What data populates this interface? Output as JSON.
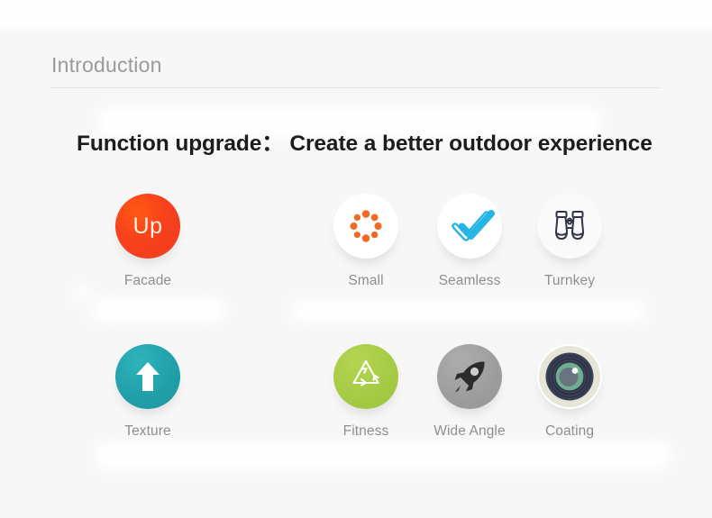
{
  "header": {
    "title": "Introduction"
  },
  "main": {
    "heading": "Function upgrade：  Create a better outdoor experience"
  },
  "features": {
    "rows": [
      {
        "items": [
          {
            "label": "Facade",
            "icon": "up-circle-icon",
            "icon_text": "Up",
            "color": "#f8421b"
          },
          {
            "label": "Small",
            "icon": "dot-spinner-icon",
            "icon_text": "",
            "color": "#f26a21"
          },
          {
            "label": "Seamless",
            "icon": "double-check-icon",
            "icon_text": "",
            "color": "#27b5e5"
          },
          {
            "label": "Turnkey",
            "icon": "binoculars-icon",
            "icon_text": "",
            "color": "#2f3446"
          }
        ]
      },
      {
        "items": [
          {
            "label": "Texture",
            "icon": "arrow-up-circle-icon",
            "icon_text": "",
            "color": "#21a0aa"
          },
          {
            "label": "Fitness",
            "icon": "recycle-icon",
            "icon_text": "",
            "color": "#a6cb45"
          },
          {
            "label": "Wide Angle",
            "icon": "rocket-icon",
            "icon_text": "",
            "color": "#9e9e9e"
          },
          {
            "label": "Coating",
            "icon": "camera-lens-icon",
            "icon_text": "",
            "color": "#3a4156"
          }
        ]
      }
    ]
  },
  "colors": {
    "background": "#f7f7f7",
    "header_text": "#9a9a9a",
    "heading_text": "#1c1c1c",
    "label_text": "#8e8e8e",
    "rule": "#e2e2e2"
  }
}
